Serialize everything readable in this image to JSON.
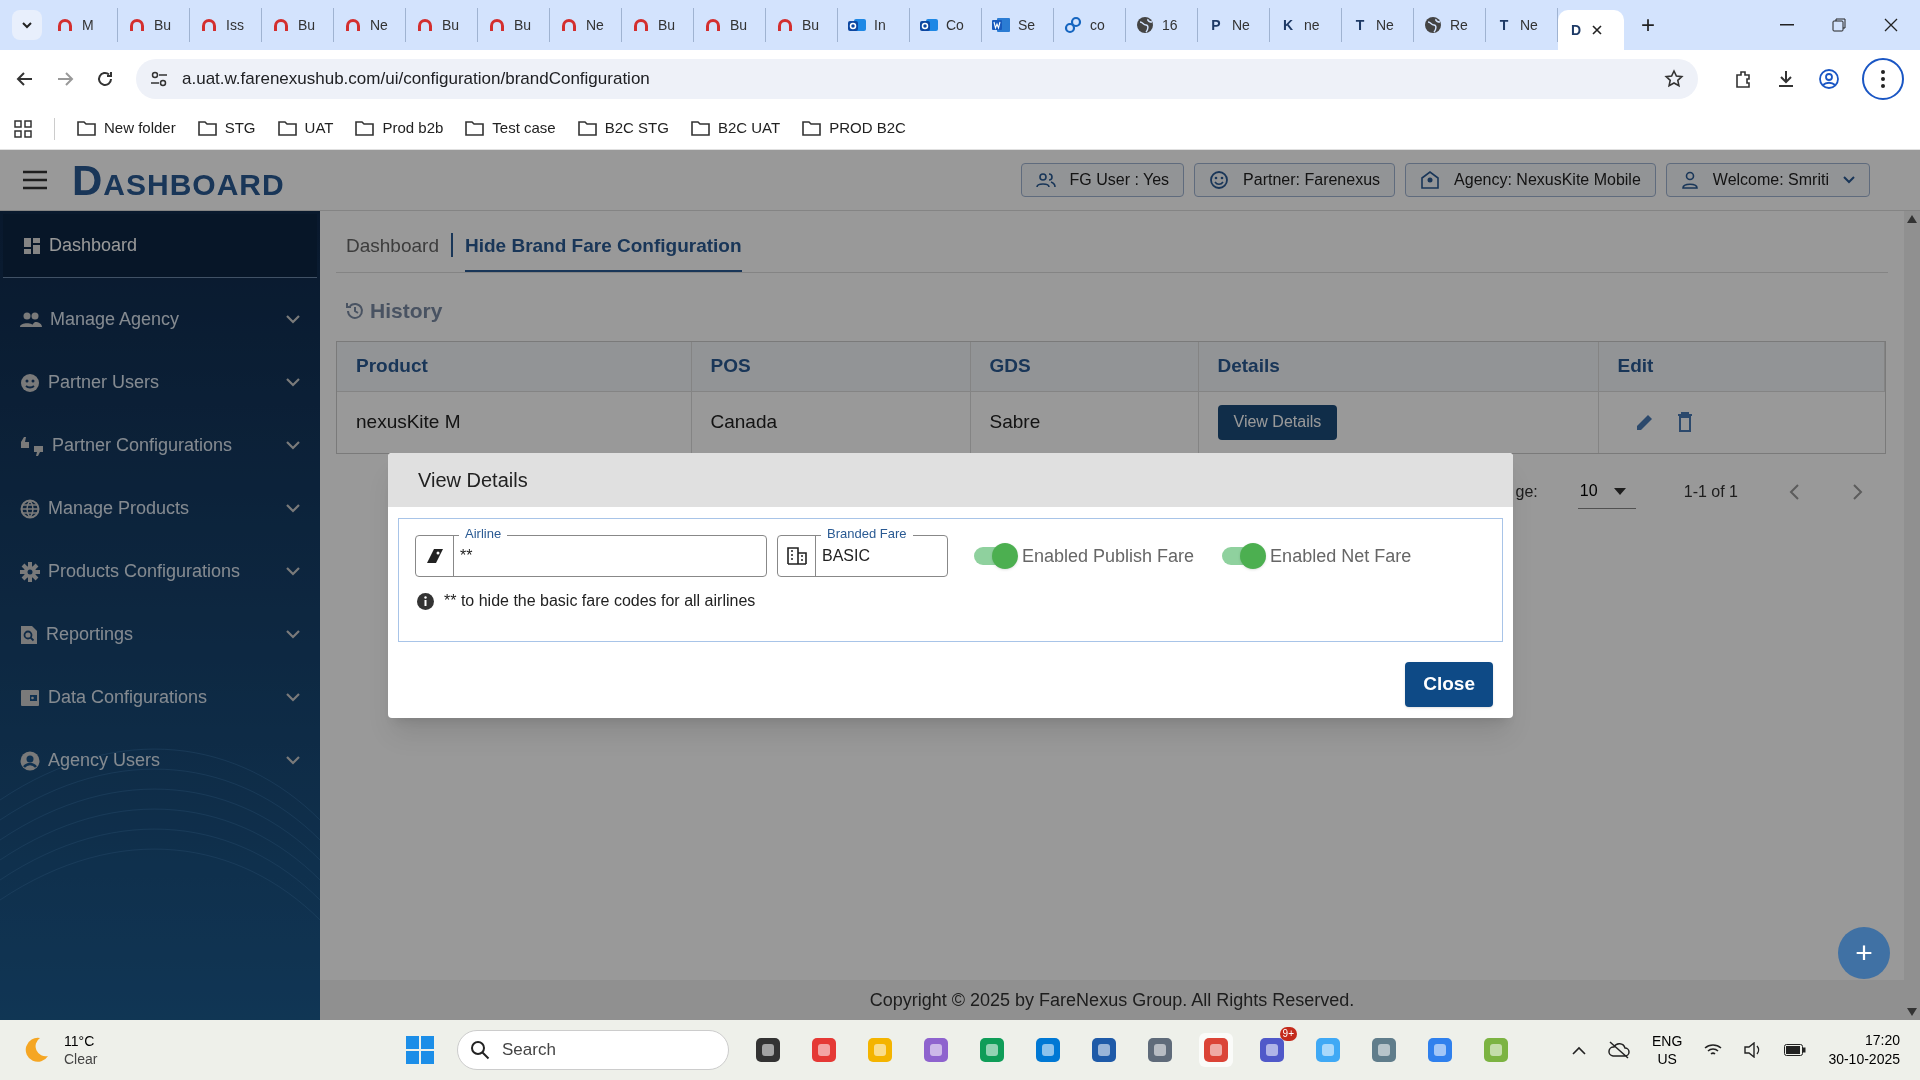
{
  "browser": {
    "tabs": [
      {
        "kind": "arch",
        "label": "M",
        "selected": false
      },
      {
        "kind": "arch",
        "label": "Bu",
        "selected": false
      },
      {
        "kind": "arch",
        "label": "Iss",
        "selected": false
      },
      {
        "kind": "arch",
        "label": "Bu",
        "selected": false
      },
      {
        "kind": "arch",
        "label": "Ne",
        "selected": false
      },
      {
        "kind": "arch",
        "label": "Bu",
        "selected": false
      },
      {
        "kind": "arch",
        "label": "Bu",
        "selected": false
      },
      {
        "kind": "arch",
        "label": "Ne",
        "selected": false
      },
      {
        "kind": "arch",
        "label": "Bu",
        "selected": false
      },
      {
        "kind": "arch",
        "label": "Bu",
        "selected": false
      },
      {
        "kind": "arch",
        "label": "Bu",
        "selected": false
      },
      {
        "kind": "mail",
        "label": "In",
        "selected": false
      },
      {
        "kind": "mail",
        "label": "Co",
        "selected": false
      },
      {
        "kind": "doc",
        "label": "Se",
        "selected": false
      },
      {
        "kind": "link",
        "label": "co",
        "selected": false
      },
      {
        "kind": "globe",
        "label": "16",
        "selected": false
      },
      {
        "kind": "letter",
        "icon_text": "P",
        "label": "Ne",
        "selected": false
      },
      {
        "kind": "letter",
        "icon_text": "K",
        "label": "ne",
        "selected": false
      },
      {
        "kind": "letter",
        "icon_text": "T",
        "label": "Ne",
        "selected": false
      },
      {
        "kind": "globe",
        "label": "Re",
        "selected": false
      },
      {
        "kind": "letter",
        "icon_text": "T",
        "label": "Ne",
        "selected": false
      },
      {
        "kind": "letter",
        "icon_text": "D",
        "selected": true
      }
    ],
    "new_tab": "+",
    "url": "a.uat.w.farenexushub.com/ui/configuration/brandConfiguration",
    "bookmarks": [
      "New folder",
      "STG",
      "UAT",
      "Prod b2b",
      "Test case",
      "B2C STG",
      "B2C UAT",
      "PROD B2C"
    ]
  },
  "logo": "DASHBOARD",
  "header_badges": [
    {
      "kind": "users",
      "label": "FG User : Yes"
    },
    {
      "kind": "partner",
      "label": "Partner: Farenexus"
    },
    {
      "kind": "agency",
      "label": "Agency: NexusKite Mobile"
    },
    {
      "kind": "welcome",
      "label": "Welcome: Smriti"
    }
  ],
  "sidebar": {
    "items": [
      {
        "kind": "link",
        "label": "Dashboard",
        "selected": true
      },
      {
        "kind": "group",
        "label": "Manage Agency",
        "selected": false
      },
      {
        "kind": "group",
        "label": "Partner Users",
        "selected": false
      },
      {
        "kind": "group",
        "label": "Partner Configurations",
        "selected": false
      },
      {
        "kind": "group",
        "label": "Manage Products",
        "selected": false
      },
      {
        "kind": "group",
        "label": "Products Configurations",
        "selected": false
      },
      {
        "kind": "group",
        "label": "Reportings",
        "selected": false
      },
      {
        "kind": "group",
        "label": "Data Configurations",
        "selected": false
      },
      {
        "kind": "group",
        "label": "Agency Users",
        "selected": false
      }
    ]
  },
  "breadcrumb": [
    {
      "label": "Dashboard",
      "selected": false
    },
    {
      "label": "Hide Brand Fare Configuration",
      "selected": true
    }
  ],
  "section_title": "History",
  "table": {
    "columns": [
      "Product",
      "POS",
      "GDS",
      "Details",
      "Edit"
    ],
    "rows": [
      {
        "cells": [
          "nexusKite M",
          "Canada",
          "Sabre"
        ],
        "action": "View Details"
      }
    ]
  },
  "pagination": {
    "rows_label": "ge:",
    "rows_per_page": "10",
    "range": "1-1 of 1"
  },
  "footer": "Copyright © 2025 by FareNexus Group. All Rights Reserved.",
  "fab": "+",
  "modal": {
    "title": "View Details",
    "fields": [
      {
        "kind": "airline",
        "label": "Airline",
        "value": "**"
      },
      {
        "kind": "fare",
        "label": "Branded Fare",
        "value": "BASIC"
      }
    ],
    "note": "** to hide the basic fare codes for all airlines",
    "toggles": [
      {
        "label": "Enabled Publish Fare",
        "on": true
      },
      {
        "label": "Enabled Net Fare",
        "on": true
      }
    ],
    "close": "Close"
  },
  "taskbar": {
    "temperature": "11°C",
    "condition": "Clear",
    "search": "Search",
    "badge": "9+",
    "lang": "ENG",
    "region": "US",
    "time": "17:20",
    "date": "30-10-2025"
  }
}
